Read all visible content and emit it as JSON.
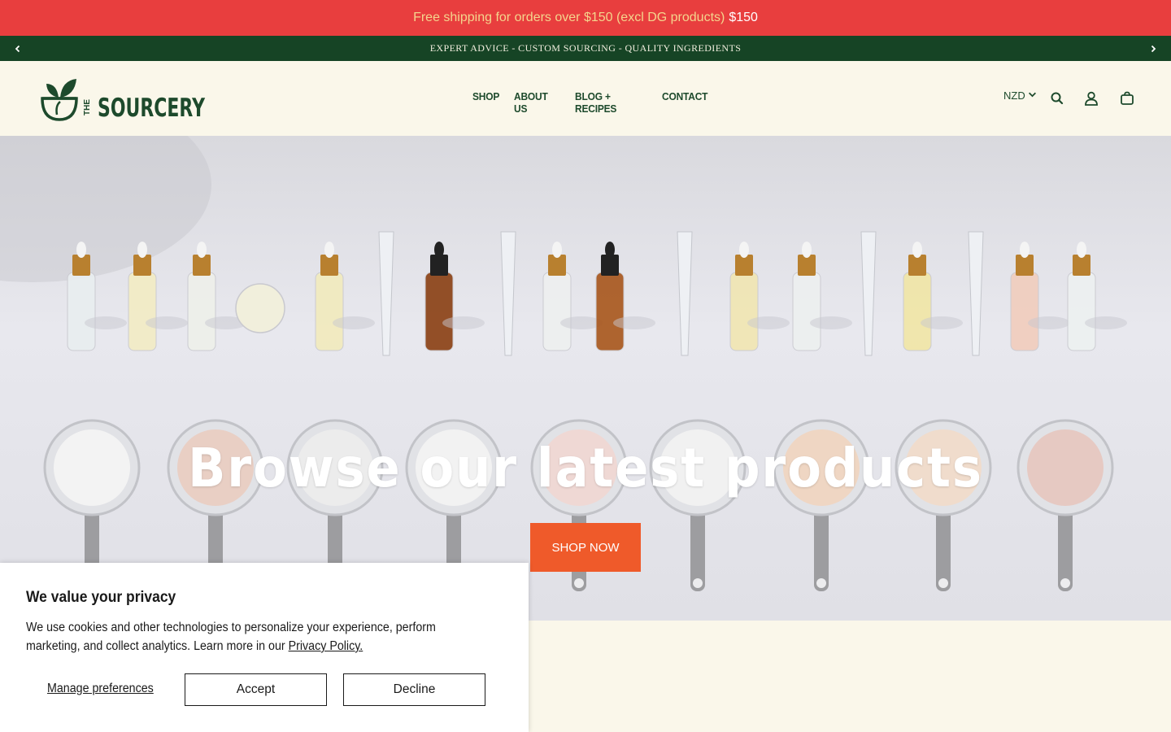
{
  "promo": {
    "text": "Free shipping for orders over $150 (excl DG products)",
    "amount": "$150"
  },
  "announcement": {
    "text": "EXPERT ADVICE - CUSTOM SOURCING - QUALITY INGREDIENTS",
    "prev_icon": "chevron-left-icon",
    "next_icon": "chevron-right-icon"
  },
  "header": {
    "logo_top": "THE",
    "logo_main": "SOURCERY",
    "nav": [
      {
        "label": "SHOP"
      },
      {
        "label": "ABOUT US"
      },
      {
        "label": "BLOG + RECIPES"
      },
      {
        "label": "CONTACT"
      }
    ],
    "currency": "NZD",
    "icons": [
      "search-icon",
      "account-icon",
      "cart-icon"
    ]
  },
  "hero": {
    "title": "Browse our latest products",
    "button": "SHOP NOW"
  },
  "cookie": {
    "title": "We value your privacy",
    "body": "We use cookies and other technologies to personalize your experience, perform marketing, and collect analytics. Learn more in our",
    "link": "Privacy Policy.",
    "manage": "Manage preferences",
    "accept": "Accept",
    "decline": "Decline"
  },
  "colors": {
    "promo_bg": "#e83e3e",
    "announce_bg": "#164425",
    "brand_green": "#1d4a2c",
    "cta_orange": "#ef5a2a",
    "header_bg": "#faf7ea"
  }
}
